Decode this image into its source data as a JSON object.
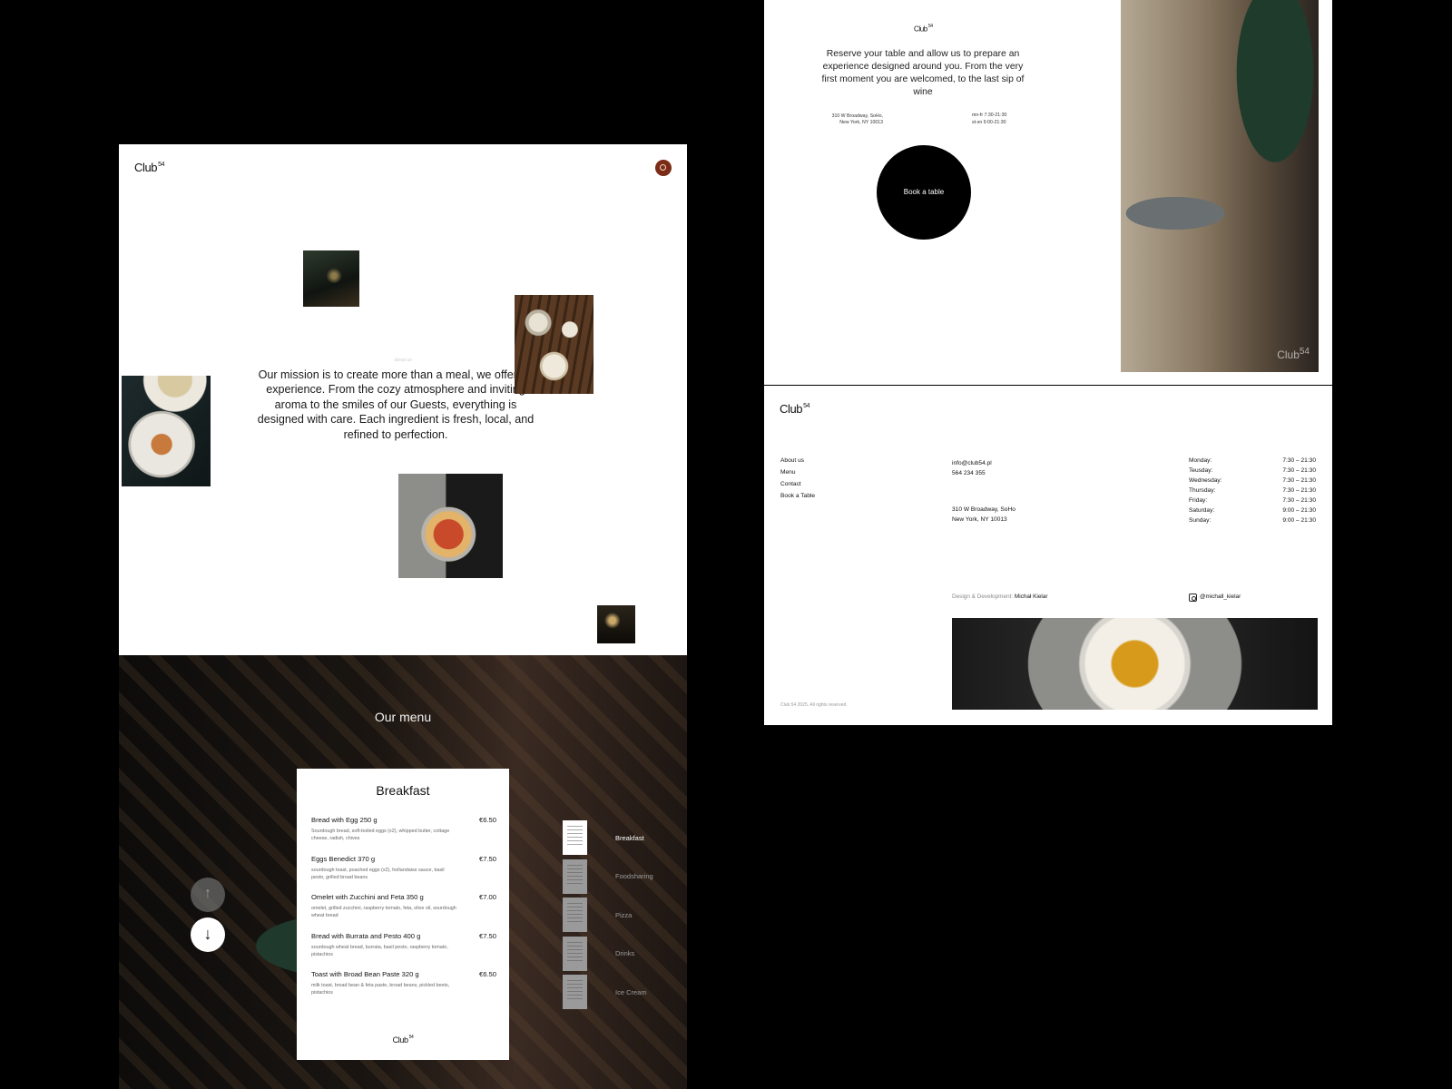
{
  "brand": {
    "name": "Club",
    "superscript": "54"
  },
  "about": {
    "kicker": "about us",
    "mission": "Our mission is to create more than a meal, we offer an experience. From the cozy atmosphere and inviting aroma to the smiles of our Guests, everything is designed with care. Each ingredient is fresh, local, and refined to perfection."
  },
  "menu": {
    "title": "Our menu",
    "card_title": "Breakfast",
    "items": [
      {
        "name": "Bread with Egg 250 g",
        "price": "€6.50",
        "desc": "Sourdough bread, soft-boiled eggs (x2), whipped butter, cottage cheese, radish, chives"
      },
      {
        "name": "Eggs Benedict 370 g",
        "price": "€7.50",
        "desc": "sourdough toast, poached eggs (x2), hollandaise sauce, basil pesto, grilled broad beans"
      },
      {
        "name": "Omelet with Zucchini and Feta 350 g",
        "price": "€7.00",
        "desc": "omelet, grilled zucchini, raspberry tomato, feta, olive oil, sourdough wheat bread"
      },
      {
        "name": "Bread with Burrata and Pesto 400 g",
        "price": "€7.50",
        "desc": "sourdough wheat bread, burrata, basil pesto, raspberry tomato, pistachios"
      },
      {
        "name": "Toast with Broad Bean Paste 320 g",
        "price": "€6.50",
        "desc": "milk toast, broad bean & feta paste, broad beans, pickled beets, pistachios"
      }
    ],
    "up_arrow": "↑",
    "down_arrow": "↓",
    "categories": [
      "Breakfast",
      "Foodsharing",
      "Pizza",
      "Drinks",
      "Ice Cream"
    ]
  },
  "reserve": {
    "text": "Reserve your table and allow us to prepare an experience designed around you. From the very first moment you are welcomed, to the last sip of wine",
    "address_line1": "310 W Broadway, SoHo,",
    "address_line2": "New York, NY 10013",
    "hours_line1": "mn-fr 7:30-21:30",
    "hours_line2": "st-sn 9:00-21:30",
    "book_label": "Book a table"
  },
  "footer": {
    "links": [
      "About us",
      "Menu",
      "Contact",
      "Book a Table"
    ],
    "email": "info@club54.pl",
    "phone": "564 234 355",
    "address_line1": "310 W Broadway, SoHo",
    "address_line2": "New York, NY 10013",
    "hours": [
      {
        "day": "Monday:",
        "time": "7:30 – 21:30"
      },
      {
        "day": "Teusday:",
        "time": "7:30 – 21:30"
      },
      {
        "day": "Wednesday:",
        "time": "7:30 – 21:30"
      },
      {
        "day": "Thursday:",
        "time": "7:30 – 21:30"
      },
      {
        "day": "Friday:",
        "time": "7:30 – 21:30"
      },
      {
        "day": "Saturday:",
        "time": "9:00 – 21:30"
      },
      {
        "day": "Sunday:",
        "time": "9:00 – 21:30"
      }
    ],
    "credit_label": "Design & Development:",
    "credit_name": "Michał Kielar",
    "instagram": "@michall_kielar",
    "copyright": "Club 54 2025. All rights reserved."
  }
}
